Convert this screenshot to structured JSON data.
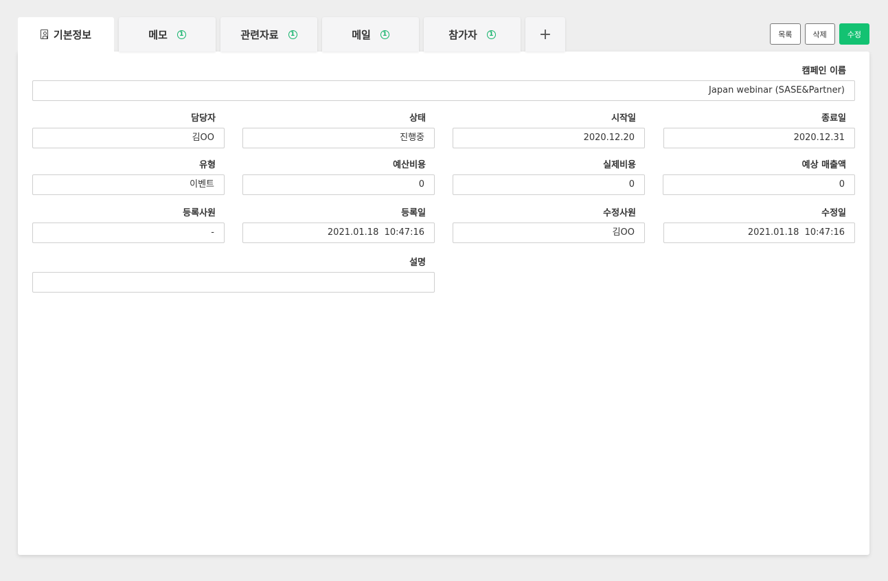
{
  "tabs": [
    {
      "label": "기본정보",
      "badge": ""
    },
    {
      "label": "메모",
      "badge": "1"
    },
    {
      "label": "관련자료",
      "badge": "1"
    },
    {
      "label": "메일",
      "badge": "1"
    },
    {
      "label": "참가자",
      "badge": "1"
    },
    {
      "label": "+",
      "badge": ""
    }
  ],
  "actions": {
    "list": "목록",
    "delete": "삭제",
    "edit": "수정"
  },
  "fields": {
    "campaign_name": {
      "label": "캠페인 이름",
      "value": "Japan webinar (SASE&Partner)"
    },
    "owner": {
      "label": "담당자",
      "value": "김OO"
    },
    "status": {
      "label": "상태",
      "value": "진행중"
    },
    "start_date": {
      "label": "시작일",
      "value": "2020.12.20"
    },
    "end_date": {
      "label": "종료일",
      "value": "2020.12.31"
    },
    "type": {
      "label": "유형",
      "value": "이벤트"
    },
    "budget_cost": {
      "label": "예산비용",
      "value": "0"
    },
    "actual_cost": {
      "label": "실제비용",
      "value": "0"
    },
    "expected_revenue": {
      "label": "예상 매출액",
      "value": "0"
    },
    "registered_by": {
      "label": "등록사원",
      "value": "-"
    },
    "registered_date": {
      "label": "등록일",
      "value": "2021.01.18  10:47:16"
    },
    "modified_by": {
      "label": "수정사원",
      "value": "김OO"
    },
    "modified_date": {
      "label": "수정일",
      "value": "2021.01.18  10:47:16"
    },
    "description": {
      "label": "설명",
      "value": ""
    }
  },
  "colors": {
    "accent": "#13c272",
    "badge": "#13b36b",
    "background": "#eeeeee"
  }
}
